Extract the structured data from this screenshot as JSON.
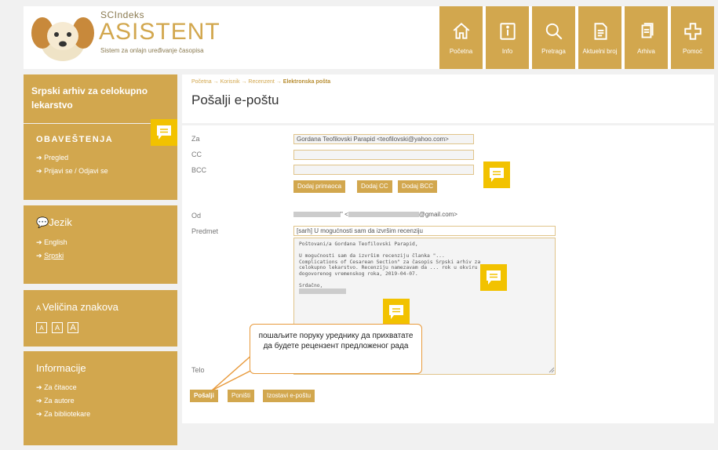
{
  "header": {
    "logo_small": "SCIndeks",
    "logo_big": "ASISTENT",
    "logo_tag": "Sistem za onlajn uređivanje časopisa",
    "nav": [
      {
        "label": "Početna",
        "icon": "home-icon"
      },
      {
        "label": "Info",
        "icon": "info-icon"
      },
      {
        "label": "Pretraga",
        "icon": "search-icon"
      },
      {
        "label": "Aktuelni broj",
        "icon": "document-icon"
      },
      {
        "label": "Arhiva",
        "icon": "archive-icon"
      },
      {
        "label": "Pomoć",
        "icon": "help-icon"
      }
    ]
  },
  "sidebar": {
    "journal": "Srpski arhiv za celokupno lekarstvo",
    "notice_title": "OBAVEŠTENJA",
    "notice_links": [
      "Pregled",
      "Prijavi se / Odjavi se"
    ],
    "lang_title": "Jezik",
    "lang_links": [
      "English",
      "Srpski"
    ],
    "font_title": "Veličina znakova",
    "font_sizes": [
      "A",
      "A",
      "A"
    ],
    "info_title": "Informacije",
    "info_links": [
      "Za čitaoce",
      "Za autore",
      "Za bibliotekare"
    ]
  },
  "breadcrumb": {
    "items": [
      "Početna",
      "Korisnik",
      "Recenzent"
    ],
    "current": "Elektronska pošta",
    "sep": "→"
  },
  "page_title": "Pošalji e-poštu",
  "form": {
    "to_label": "Za",
    "to_value": "Gordana Teofilovski Parapid <teofilovski@yahoo.com>",
    "cc_label": "CC",
    "bcc_label": "BCC",
    "add_recipient": "Dodaj primaoca",
    "add_cc": "Dodaj CC",
    "add_bcc": "Dodaj BCC",
    "from_label": "Od",
    "from_lt": "\" <",
    "from_domain": "@gmail.com>",
    "subject_label": "Predmet",
    "subject_value": "[sarh] U mogućnosti sam da izvršim recenziju",
    "body_label": "Telo",
    "body_l1": "Poštovani/a Gordana Teofilovski Parapid,",
    "body_l2": "U mogućnosti sam da izvršim recenziju članka \"...",
    "body_l3": "Complications of Cesarean Section\" za časopis Srpski arhiv za",
    "body_l4": "celokupno lekarstvo. Recenziju namezavam da ... rok u okviru ustar",
    "body_l5": "dogovorenog vremenskog roka, 2019-04-07.",
    "body_l6": "Srdačno,",
    "send": "Pošalji",
    "reset": "Poništi",
    "skip": "Izostavi e-poštu"
  },
  "callout": "пошаљите поруку уреднику да прихватате да будете рецензент предложеног рада",
  "colors": {
    "accent": "#d2a74e",
    "note": "#f2c200",
    "callout_border": "#e89a3c"
  }
}
